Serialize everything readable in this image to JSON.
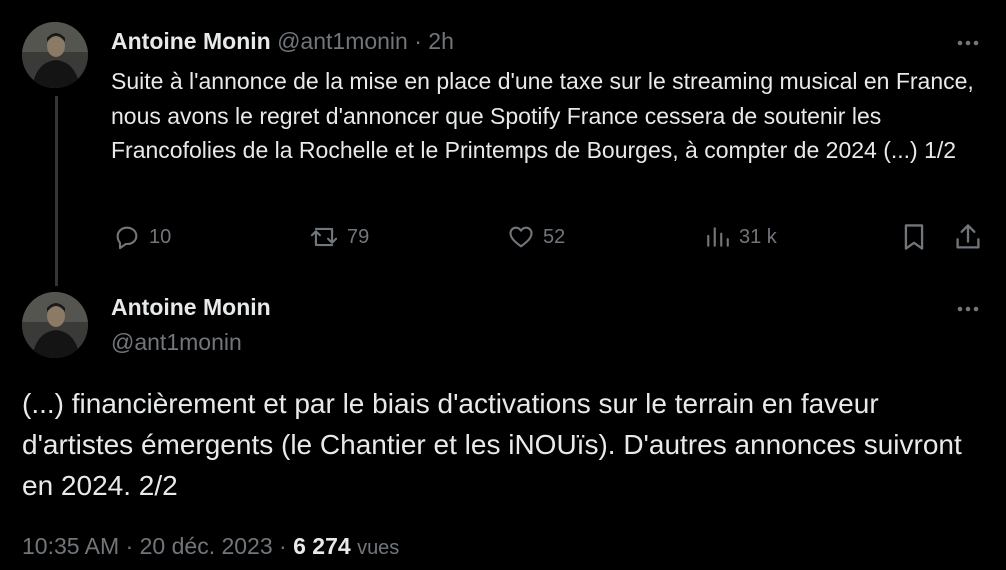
{
  "tweet1": {
    "author_name": "Antoine Monin",
    "handle": "@ant1monin",
    "separator": "·",
    "time": "2h",
    "text": "Suite à l'annonce de la mise en place d'une taxe sur le streaming musical en France, nous avons le regret d'annoncer que Spotify France cessera de soutenir les Francofolies de la Rochelle et le Printemps de Bourges, à compter de 2024 (...) 1/2",
    "actions": {
      "replies": "10",
      "reposts": "79",
      "likes": "52",
      "views": "31 k"
    }
  },
  "tweet2": {
    "author_name": "Antoine Monin",
    "handle": "@ant1monin",
    "text": "(...) financièrement et par le biais d'activations sur le terrain en faveur d'artistes émergents (le Chantier et les iNOUïs). D'autres annonces suivront en 2024. 2/2",
    "meta": {
      "time": "10:35 AM",
      "sep1": "·",
      "date": "20 déc. 2023",
      "sep2": "·",
      "views_count": "6 274",
      "views_label": "vues"
    }
  },
  "colors": {
    "background": "#000000",
    "text": "#e7e9ea",
    "muted": "#71767b",
    "thread_line": "#333639"
  },
  "icons": [
    "more-icon",
    "reply-icon",
    "repost-icon",
    "like-icon",
    "views-icon",
    "bookmark-icon",
    "share-icon"
  ]
}
